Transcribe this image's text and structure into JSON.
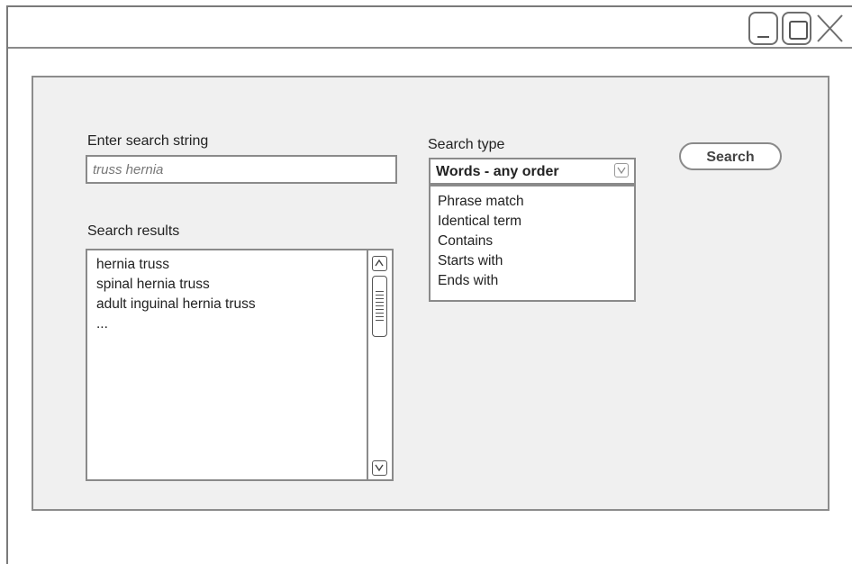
{
  "window": {
    "controls": [
      "minimize-icon",
      "maximize-icon",
      "close-icon"
    ]
  },
  "search": {
    "label": "Enter search string",
    "value": "truss hernia"
  },
  "search_type": {
    "label": "Search type",
    "selected": "Words - any order",
    "options": [
      "Phrase match",
      "Identical term",
      "Contains",
      "Starts with",
      "Ends with"
    ]
  },
  "search_button": {
    "label": "Search"
  },
  "results": {
    "label": "Search results",
    "items": [
      "hernia truss",
      "spinal hernia truss",
      "adult inguinal hernia truss",
      "..."
    ]
  }
}
